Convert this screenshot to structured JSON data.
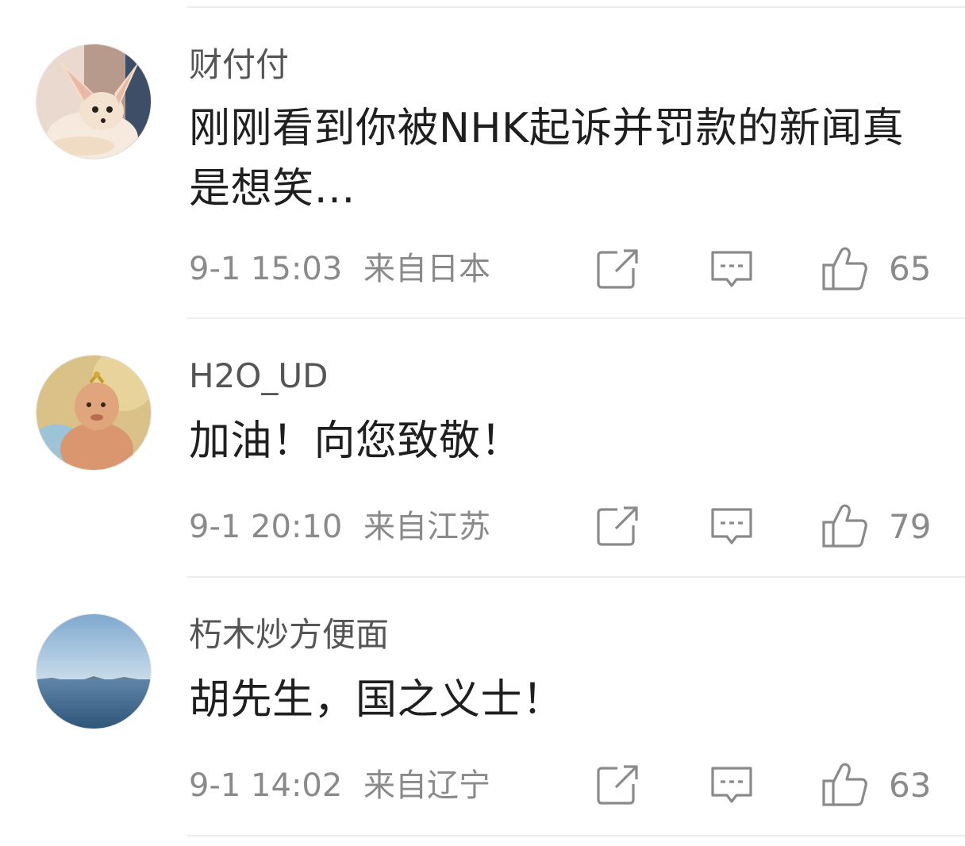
{
  "comments": [
    {
      "username": "财付付",
      "content": "刚刚看到你被NHK起诉并罚款的新闻真是想笑…",
      "time": "9-1 15:03",
      "location": "来自日本",
      "likes": "65",
      "avatar_icon": "fennec-fox-avatar"
    },
    {
      "username": "H2O_UD",
      "content": "加油！向您致敬！",
      "time": "9-1 20:10",
      "location": "来自江苏",
      "likes": "79",
      "avatar_icon": "cartoon-character-avatar"
    },
    {
      "username": "朽木炒方便面",
      "content": "胡先生，国之义士！",
      "time": "9-1 14:02",
      "location": "来自辽宁",
      "likes": "63",
      "avatar_icon": "sea-horizon-avatar"
    }
  ],
  "icons": {
    "share": "share-icon",
    "comment": "comment-icon",
    "like": "thumbs-up-icon"
  },
  "colors": {
    "username": "#555555",
    "content": "#1f1f1f",
    "meta": "#8a8a8a",
    "divider": "#ececec"
  }
}
